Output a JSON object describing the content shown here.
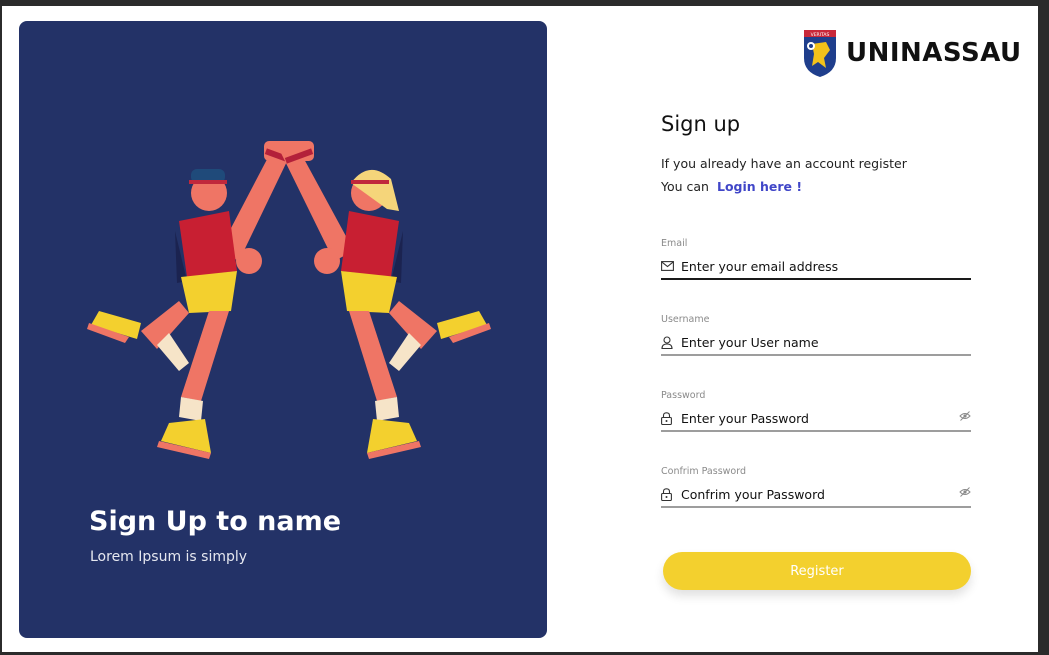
{
  "hero": {
    "title": "Sign Up to name",
    "subtitle": "Lorem Ipsum is simply"
  },
  "logo": {
    "name": "UNINASSAU",
    "emblem": "shield-eagle-icon",
    "ribbon_text": "VERITAS"
  },
  "form": {
    "title": "Sign up",
    "note": "If you already have an account register",
    "prompt": "You can",
    "login_link": "Login here !",
    "fields": [
      {
        "label": "Email",
        "placeholder": "Enter your email address",
        "icon": "mail-icon"
      },
      {
        "label": "Username",
        "placeholder": "Enter your User name",
        "icon": "user-icon"
      },
      {
        "label": "Password",
        "placeholder": "Enter your Password",
        "icon": "lock-icon"
      },
      {
        "label": "Confrim Password",
        "placeholder": "Confrim your Password",
        "icon": "lock-icon"
      }
    ],
    "register_label": "Register"
  },
  "colors": {
    "hero_bg": "#233267",
    "accent": "#f3d02e",
    "link": "#4046c8"
  }
}
